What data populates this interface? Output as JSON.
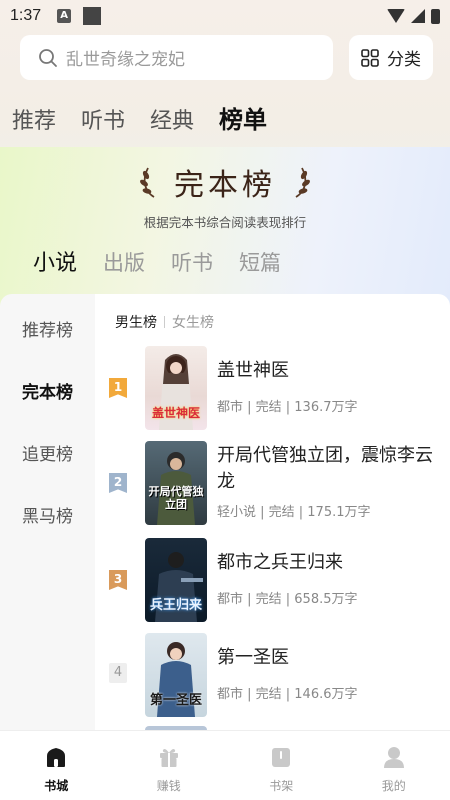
{
  "status": {
    "time": "1:37",
    "a_icon": "A"
  },
  "search": {
    "placeholder": "乱世奇缘之宠妃"
  },
  "category_button": {
    "label": "分类"
  },
  "tabs": [
    "推荐",
    "听书",
    "经典",
    "榜单"
  ],
  "banner": {
    "title": "完本榜",
    "subtitle": "根据完本书综合阅读表现排行"
  },
  "subtabs": [
    "小说",
    "出版",
    "听书",
    "短篇"
  ],
  "sidebar": [
    "推荐榜",
    "完本榜",
    "追更榜",
    "黑马榜"
  ],
  "gender": {
    "male": "男生榜",
    "female": "女生榜"
  },
  "books": [
    {
      "rank": "1",
      "title": "盖世神医",
      "meta": "都市 | 完结 | 136.7万字",
      "cover_text": "盖世神医",
      "badge_color": "#f2a93b"
    },
    {
      "rank": "2",
      "title": "开局代管独立团，震惊李云龙",
      "meta": "轻小说 | 完结 | 175.1万字",
      "cover_text": "开局代管独立团",
      "badge_color": "#9fb4cc"
    },
    {
      "rank": "3",
      "title": "都市之兵王归来",
      "meta": "都市 | 完结 | 658.5万字",
      "cover_text": "兵王归来",
      "badge_color": "#d99a5b"
    },
    {
      "rank": "4",
      "title": "第一圣医",
      "meta": "都市 | 完结 | 146.6万字",
      "cover_text": "第一圣医",
      "badge_color": "#eeeeee"
    }
  ],
  "bottom_nav": [
    "书城",
    "赚钱",
    "书架",
    "我的"
  ]
}
